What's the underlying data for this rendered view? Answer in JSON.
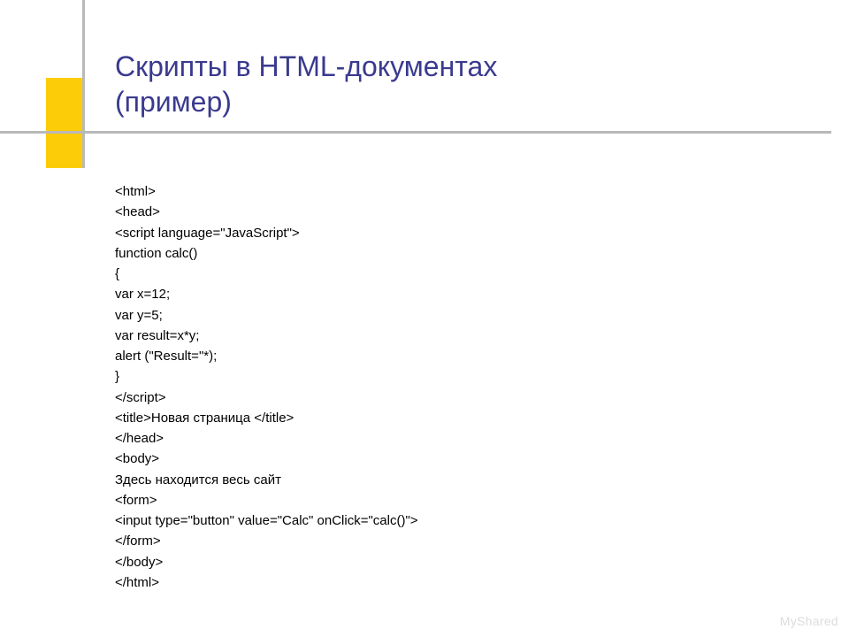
{
  "title": {
    "line1": "Скрипты в HTML-документах",
    "line2": "(пример)"
  },
  "code_lines": [
    "<html>",
    "<head>",
    "<script language=\"JavaScript\">",
    "function calc()",
    "{",
    "var x=12;",
    "var y=5;",
    "var result=x*y;",
    "alert (\"Result=\"*);",
    "}",
    "</script>",
    "<title>Новая страница </title>",
    "</head>",
    "<body>",
    "Здесь находится весь сайт",
    "<form>",
    "<input type=\"button\" value=\"Calc\" onClick=\"calc()\">",
    "</form>",
    "</body>",
    "</html>"
  ],
  "watermark": "MyShared",
  "decor": {
    "yellow_color": "#fdcc09",
    "gray_color": "#b9b9b9"
  }
}
